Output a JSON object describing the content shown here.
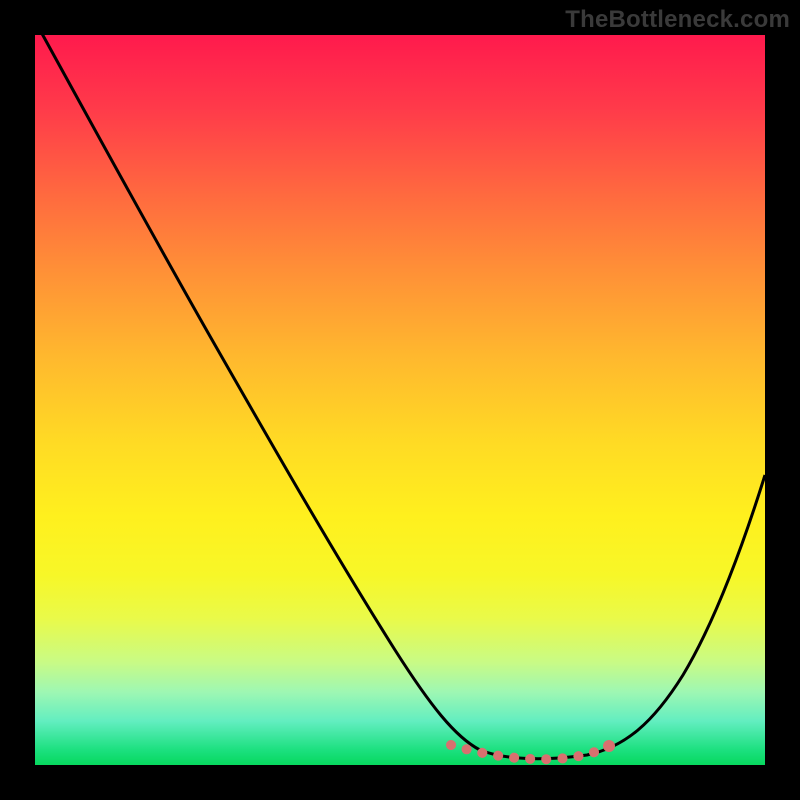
{
  "watermark": "TheBottleneck.com",
  "chart_data": {
    "type": "line",
    "title": "",
    "xlabel": "",
    "ylabel": "",
    "xlim": [
      0,
      100
    ],
    "ylim": [
      0,
      100
    ],
    "background_gradient": {
      "top_color": "#ff1a4d",
      "bottom_color": "#07d85e",
      "stops": [
        "red",
        "orange",
        "yellow",
        "green"
      ]
    },
    "series": [
      {
        "name": "bottleneck-curve",
        "stroke": "#000000",
        "x": [
          0,
          5,
          10,
          15,
          20,
          25,
          30,
          35,
          40,
          45,
          50,
          55,
          58,
          60,
          64,
          68,
          72,
          76,
          80,
          85,
          90,
          95,
          100
        ],
        "y": [
          100,
          92,
          83,
          74,
          65,
          56,
          47,
          38,
          29,
          20,
          12,
          6,
          3,
          2,
          1,
          1,
          1,
          1,
          2,
          6,
          14,
          26,
          40
        ]
      },
      {
        "name": "optimal-range-dots",
        "stroke": "#d8706f",
        "style": "dotted",
        "x": [
          57,
          60,
          63,
          66,
          69,
          72,
          75,
          78
        ],
        "y": [
          2.5,
          1.6,
          1.1,
          0.9,
          0.9,
          1.0,
          1.2,
          2.0
        ]
      }
    ],
    "markers": [
      {
        "name": "optimal-end-dot",
        "x": 78,
        "y": 2.0,
        "color": "#d8706f"
      }
    ]
  }
}
